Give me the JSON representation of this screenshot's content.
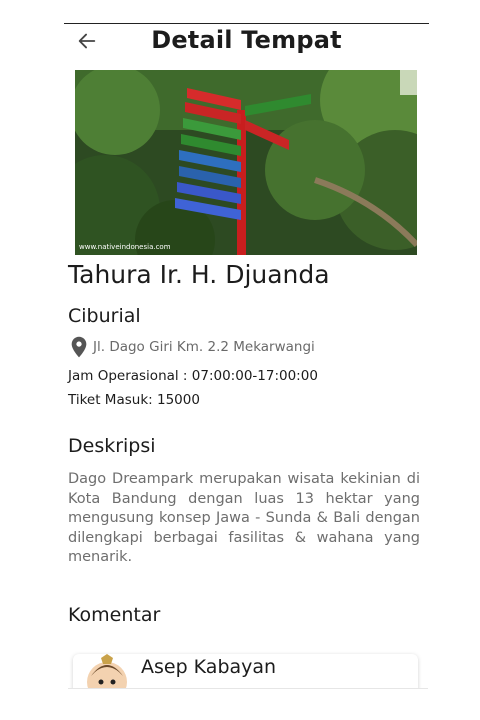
{
  "header": {
    "title": "Detail Tempat",
    "back_icon": "arrow-left-icon"
  },
  "place": {
    "image_watermark": "www.nativeindonesia.com",
    "name": "Tahura Ir. H. Djuanda",
    "city": "Ciburial",
    "address_icon": "location-pin-icon",
    "address": "Jl. Dago Giri Km. 2.2 Mekarwangi",
    "hours": "Jam Operasional : 07:00:00-17:00:00",
    "ticket": "Tiket Masuk: 15000"
  },
  "description": {
    "title": "Deskripsi",
    "text": "Dago Dreampark merupakan wisata kekinian di Kota Bandung dengan luas 13 hektar yang mengusung konsep Jawa - Sunda & Bali dengan dilengkapi berbagai fasilitas & wahana yang menarik."
  },
  "comments": {
    "title": "Komentar",
    "items": [
      {
        "author": "Asep Kabayan",
        "text": ""
      }
    ]
  },
  "colors": {
    "text_primary": "#1c1c1c",
    "text_secondary": "#6e6e6e",
    "pin": "#555555"
  }
}
